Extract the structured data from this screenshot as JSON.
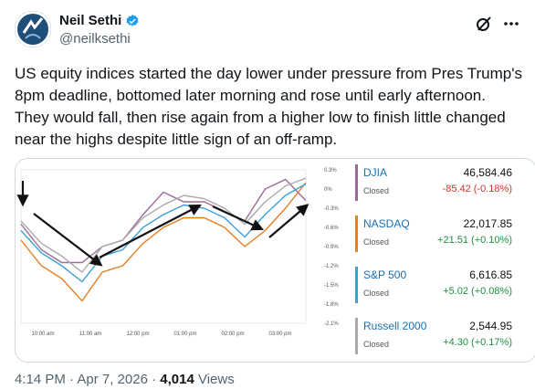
{
  "author": {
    "name": "Neil Sethi",
    "handle": "@neilksethi"
  },
  "post": {
    "text": "US equity indices started the day lower under pressure from Pres Trump's 8pm deadline, bottomed later morning and rose until early afternoon. They would fall, then rise again from a higher low to finish little changed near the highs despite little sign of an off-ramp."
  },
  "chart_data": {
    "type": "line",
    "x": [
      "10:00 am",
      "11:00 am",
      "12:00 pm",
      "01:00 pm",
      "02:00 pm",
      "03:00 pm"
    ],
    "yticks": [
      "0.3%",
      "0%",
      "-0.3%",
      "-0.6%",
      "-0.9%",
      "-1.2%",
      "-1.5%",
      "-1.8%",
      "-2.1%"
    ],
    "ylim": [
      -2.1,
      0.3
    ],
    "series": [
      {
        "name": "DJIA",
        "color": "#9b6a98",
        "values": [
          -0.55,
          -0.95,
          -1.15,
          -1.15,
          -0.9,
          -0.8,
          -0.4,
          -0.05,
          -0.2,
          -0.2,
          -0.35,
          -0.5,
          0.0,
          0.15,
          -0.18
        ]
      },
      {
        "name": "NASDAQ",
        "color": "#e67e22",
        "values": [
          -0.8,
          -1.2,
          -1.4,
          -1.75,
          -1.3,
          -1.2,
          -0.85,
          -0.6,
          -0.45,
          -0.45,
          -0.6,
          -0.9,
          -0.65,
          -0.3,
          0.1
        ]
      },
      {
        "name": "S&P 500",
        "color": "#3aa0d8",
        "values": [
          -0.65,
          -1.0,
          -1.2,
          -1.45,
          -1.05,
          -0.95,
          -0.6,
          -0.4,
          -0.25,
          -0.3,
          -0.45,
          -0.75,
          -0.4,
          -0.1,
          0.08
        ]
      },
      {
        "name": "Russell 2000",
        "color": "#aaaaaa",
        "values": [
          -0.5,
          -0.85,
          -1.05,
          -1.3,
          -0.9,
          -0.8,
          -0.45,
          -0.25,
          -0.1,
          -0.15,
          -0.3,
          -0.55,
          -0.2,
          0.05,
          0.17
        ]
      }
    ]
  },
  "quotes": [
    {
      "symbol": "DJIA",
      "status": "Closed",
      "price": "46,584.46",
      "change": "-85.42 (-0.18%)",
      "bar_color": "#9b6a98",
      "change_color": "#d0342c"
    },
    {
      "symbol": "NASDAQ",
      "status": "Closed",
      "price": "22,017.85",
      "change": "+21.51 (+0.10%)",
      "bar_color": "#e67e22",
      "change_color": "#1e8e3e"
    },
    {
      "symbol": "S&P 500",
      "status": "Closed",
      "price": "6,616.85",
      "change": "+5.02 (+0.08%)",
      "bar_color": "#3aa0d8",
      "change_color": "#1e8e3e"
    },
    {
      "symbol": "Russell 2000",
      "status": "Closed",
      "price": "2,544.95",
      "change": "+4.30 (+0.17%)",
      "bar_color": "#aaaaaa",
      "change_color": "#1e8e3e"
    }
  ],
  "meta": {
    "time": "4:14 PM · Apr 7, 2026 · ",
    "views_count": "4,014",
    "views_label": " Views"
  },
  "colors": {
    "verified": "#1d9bf0",
    "arrow": "#111111"
  }
}
